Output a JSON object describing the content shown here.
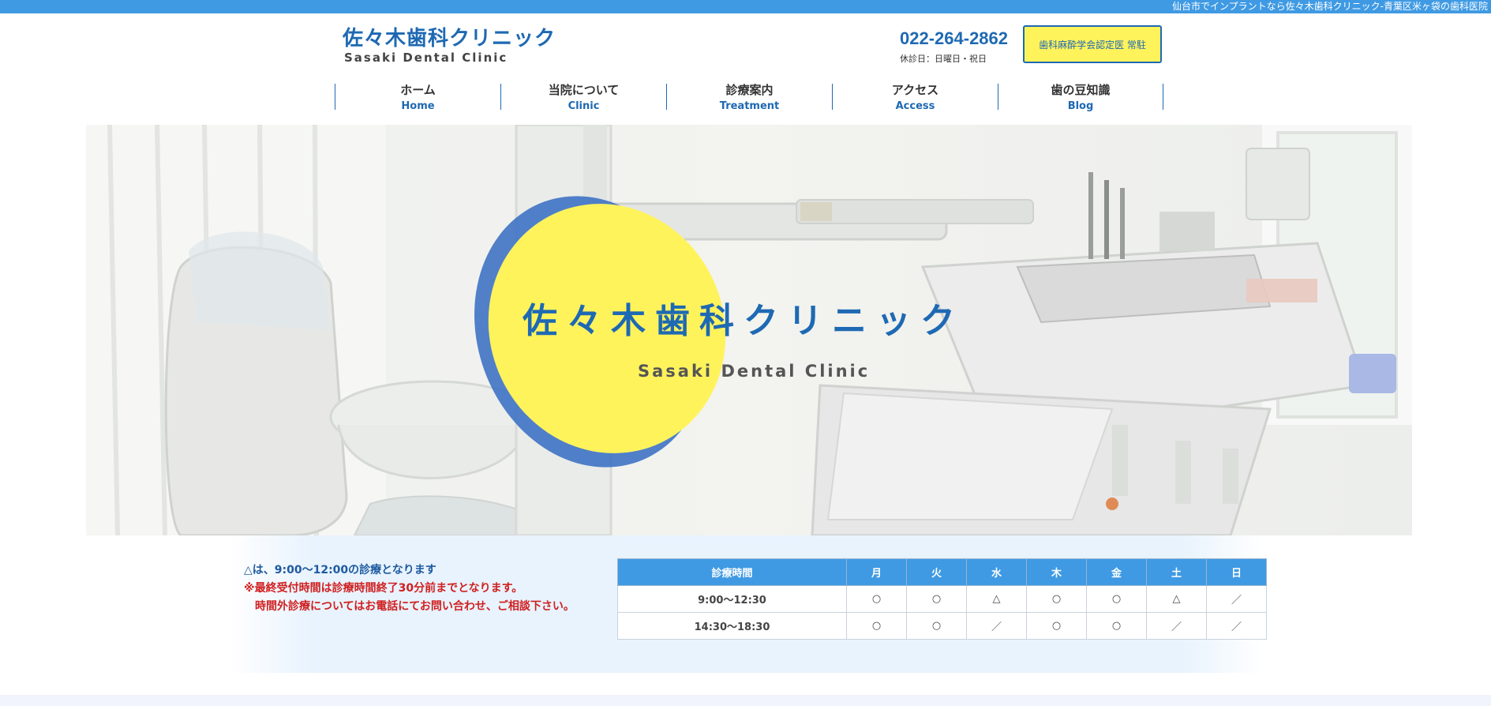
{
  "topbar": {
    "text": "仙台市でインプラントなら佐々木歯科クリニック-青葉区米ヶ袋の歯科医院"
  },
  "logo": {
    "jp": "佐々木歯科クリニック",
    "en": "Sasaki Dental Clinic"
  },
  "contact": {
    "phone": "022-264-2862",
    "closed": "休診日：日曜日・祝日"
  },
  "badge": {
    "text": "歯科麻酔学会認定医 常駐"
  },
  "nav": [
    {
      "jp": "ホーム",
      "en": "Home"
    },
    {
      "jp": "当院について",
      "en": "Clinic"
    },
    {
      "jp": "診療案内",
      "en": "Treatment"
    },
    {
      "jp": "アクセス",
      "en": "Access"
    },
    {
      "jp": "歯の豆知識",
      "en": "Blog"
    }
  ],
  "hero": {
    "title": "佐々木歯科クリニック",
    "subtitle": "Sasaki Dental Clinic"
  },
  "notes": {
    "line1": "△は、9:00〜12:00の診療となります",
    "line2": "※最終受付時間は診療時間終了30分前までとなります。",
    "line3": "時間外診療についてはお電話にてお問い合わせ、ご相談下さい。"
  },
  "schedule": {
    "header": [
      "診療時間",
      "月",
      "火",
      "水",
      "木",
      "金",
      "土",
      "日"
    ],
    "rows": [
      [
        "9:00〜12:30",
        "○",
        "○",
        "△",
        "○",
        "○",
        "△",
        "／"
      ],
      [
        "14:30〜18:30",
        "○",
        "○",
        "／",
        "○",
        "○",
        "／",
        "／"
      ]
    ]
  },
  "colors": {
    "brand_blue": "#1e69b3",
    "topbar_blue": "#3f9ae3",
    "accent_yellow": "#fff35c"
  }
}
